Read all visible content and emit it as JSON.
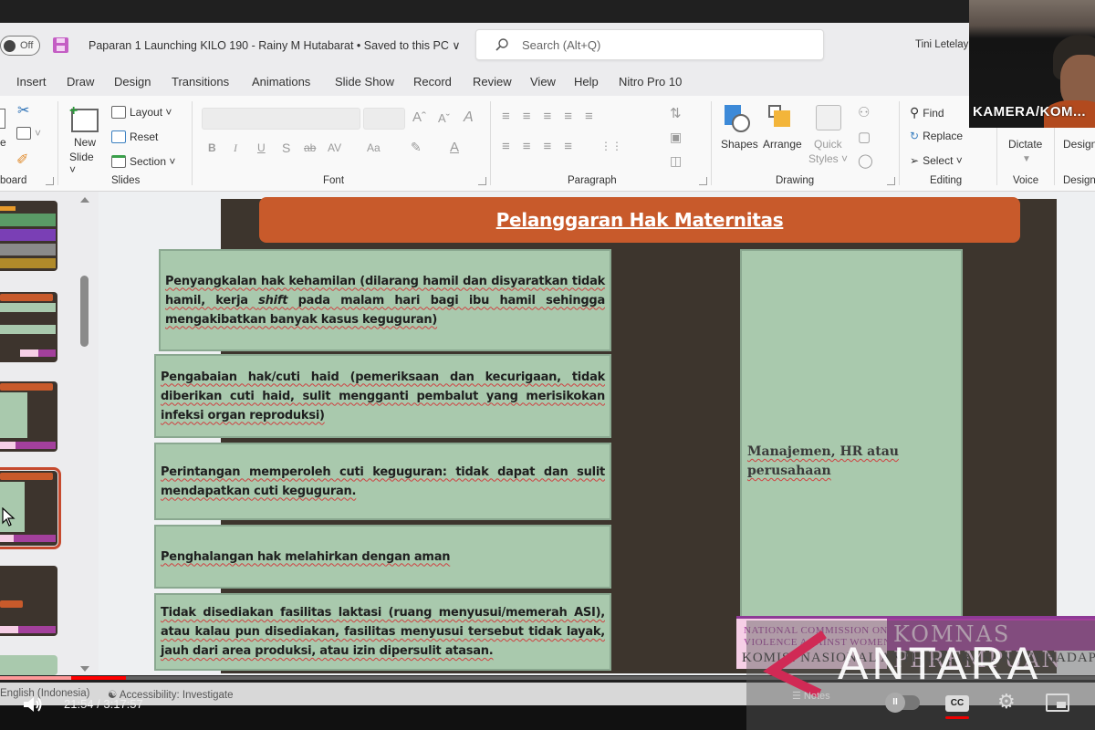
{
  "app": {
    "autosave_label": "Off",
    "doc_title": "Paparan 1 Launching KILO 190 - Rainy M Hutabarat  •  Saved to this PC ∨",
    "search_placeholder": "Search (Alt+Q)",
    "user_name": "Tini Letelay"
  },
  "tabs": [
    "Insert",
    "Draw",
    "Design",
    "Transitions",
    "Animations",
    "Slide Show",
    "Record",
    "Review",
    "View",
    "Help",
    "Nitro Pro 10"
  ],
  "ribbon": {
    "clipboard_label": "board",
    "paste_partial": "e",
    "slides": {
      "new_slide": "New",
      "new_slide2": "Slide ˅",
      "layout": "Layout ˅",
      "reset": "Reset",
      "section": "Section ˅",
      "label": "Slides"
    },
    "font": {
      "label": "Font",
      "bold": "B",
      "italic": "I",
      "underline": "U",
      "shadow": "S",
      "strike": "ab",
      "spacing": "AV",
      "case": "Aa",
      "grow": "Aˆ",
      "shrink": "Aˇ"
    },
    "paragraph": {
      "label": "Paragraph"
    },
    "drawing": {
      "label": "Drawing",
      "shapes": "Shapes",
      "arrange": "Arrange",
      "quick_styles": "Quick",
      "quick_styles2": "Styles ˅"
    },
    "editing": {
      "label": "Editing",
      "find": "Find",
      "replace": "Replace",
      "select": "Select ˅"
    },
    "voice": {
      "label": "Voice",
      "dictate": "Dictate"
    },
    "designer": {
      "label": "Designer",
      "label_btn": "Designer"
    }
  },
  "camera": {
    "label": "KAMERA/KOM..."
  },
  "slide": {
    "title": "Pelanggaran Hak Maternitas",
    "items": [
      "Penyangkalan hak kehamilan (dilarang hamil dan disyaratkan tidak hamil, kerja shift pada malam hari bagi ibu hamil sehingga mengakibatkan banyak kasus keguguran)",
      "Pengabaian hak/cuti haid (pemeriksaan dan kecurigaan, tidak diberikan cuti haid, sulit mengganti pembalut yang merisikokan infeksi organ reproduksi)",
      "Perintangan memperoleh cuti keguguran: tidak dapat dan sulit mendapatkan cuti keguguran.",
      "Penghalangan hak melahirkan dengan aman",
      "Tidak disediakan fasilitas laktasi (ruang menyusui/memerah ASI), atau kalau pun disediakan, fasilitas menyusui tersebut tidak layak, jauh dari area produksi, atau izin dipersulit atasan."
    ],
    "item1_parts": {
      "a": "Penyangkalan hak kehamilan (dilarang hamil dan disyaratkan tidak hamil, kerja ",
      "shift": "shift",
      "b": " pada malam hari bagi ibu hamil sehingga mengakibatkan banyak kasus keguguran)"
    },
    "right_column": "Manajemen, HR atau perusahaan",
    "logo": {
      "line1": "NATIONAL COMMISSION ON",
      "line2": "VIOLENCE AGAINST WOMEN",
      "big": "KOMNAS PEREMPUAN",
      "bottom": "KOMISI NASIONAL ANTI KEKERASAN TERHADAP PEREMPUAN"
    }
  },
  "statusbar": {
    "language": "English (Indonesia)",
    "accessibility": "Accessibility: Investigate",
    "notes": "Notes"
  },
  "video": {
    "time": "21:54 / 3:17:57",
    "progress": 0.115,
    "watermark": "ANTARA",
    "cc": "CC",
    "accent": "#ff0000"
  },
  "colors": {
    "slide_bg": "#3d352d",
    "title_bar": "#c85a2b",
    "box": "#a9c9ad",
    "komnas_purple": "#a3409c"
  }
}
